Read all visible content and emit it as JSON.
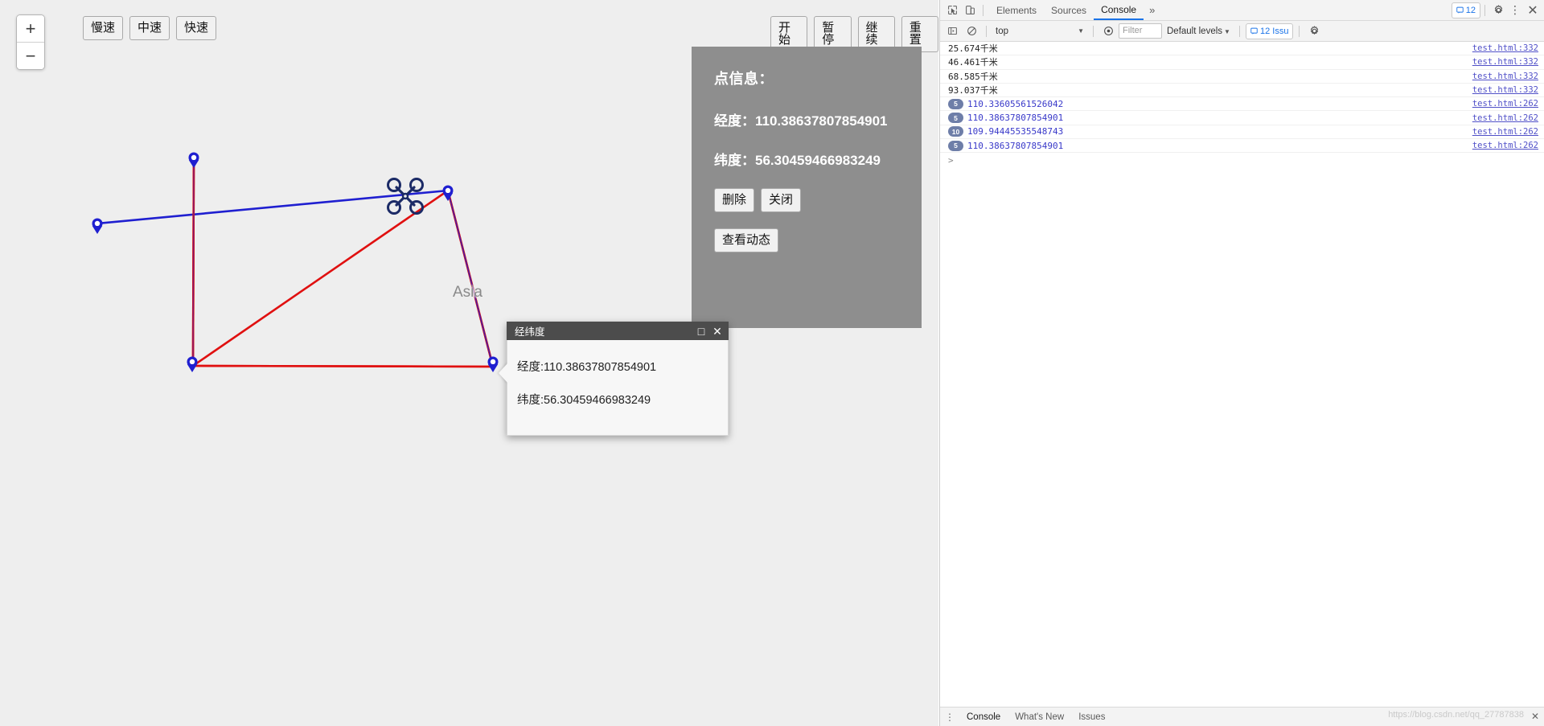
{
  "map": {
    "zoom_in_label": "+",
    "zoom_out_label": "−",
    "place_label": "Asia",
    "speed_buttons": [
      {
        "label": "慢速",
        "name": "speed-slow-button"
      },
      {
        "label": "中速",
        "name": "speed-medium-button"
      },
      {
        "label": "快速",
        "name": "speed-fast-button"
      }
    ],
    "action_buttons": [
      {
        "label": "开始",
        "name": "start-button"
      },
      {
        "label": "暂停",
        "name": "pause-button"
      },
      {
        "label": "继续",
        "name": "resume-button"
      },
      {
        "label": "重置",
        "name": "reset-button"
      }
    ]
  },
  "info_panel": {
    "title": "点信息：",
    "longitude_label": "经度：",
    "longitude_value": "110.38637807854901",
    "latitude_label": "纬度：",
    "latitude_value": "56.30459466983249",
    "delete_label": "删除",
    "close_label": "关闭",
    "dynamic_label": "查看动态",
    "bg_color": "#8e8e8e"
  },
  "dialog": {
    "title": "经纬度",
    "maximize_icon": "□",
    "close_icon": "✕",
    "line1": "经度:110.38637807854901",
    "line2": "纬度:56.30459466983249"
  },
  "devtools": {
    "tabs": [
      {
        "label": "Elements",
        "active": false
      },
      {
        "label": "Sources",
        "active": false
      },
      {
        "label": "Console",
        "active": true
      }
    ],
    "more_tabs_icon": "»",
    "issues_count": "12",
    "issues_drawer_label": "12 Issu",
    "settings_icon": "gear",
    "menu_icon": "⋮",
    "close_icon": "✕",
    "context": "top",
    "filter_placeholder": "Filter",
    "levels_label": "Default levels",
    "prompt": ">",
    "accent_color": "#1a73e8",
    "logs": [
      {
        "badge": "",
        "text": "25.674千米",
        "numeric": false,
        "source": "test.html:332"
      },
      {
        "badge": "",
        "text": "46.461千米",
        "numeric": false,
        "source": "test.html:332"
      },
      {
        "badge": "",
        "text": "68.585千米",
        "numeric": false,
        "source": "test.html:332"
      },
      {
        "badge": "",
        "text": "93.037千米",
        "numeric": false,
        "source": "test.html:332"
      },
      {
        "badge": "5",
        "text": "110.33605561526042",
        "numeric": true,
        "source": "test.html:262"
      },
      {
        "badge": "5",
        "text": "110.38637807854901",
        "numeric": true,
        "source": "test.html:262"
      },
      {
        "badge": "10",
        "text": "109.94445535548743",
        "numeric": true,
        "source": "test.html:262"
      },
      {
        "badge": "5",
        "text": "110.38637807854901",
        "numeric": true,
        "source": "test.html:262"
      }
    ],
    "drawer": {
      "tabs": [
        {
          "label": "Console",
          "active": true
        },
        {
          "label": "What's New",
          "active": false
        },
        {
          "label": "Issues",
          "active": false
        }
      ],
      "watermark": "https://blog.csdn.net/qq_27787838"
    }
  }
}
